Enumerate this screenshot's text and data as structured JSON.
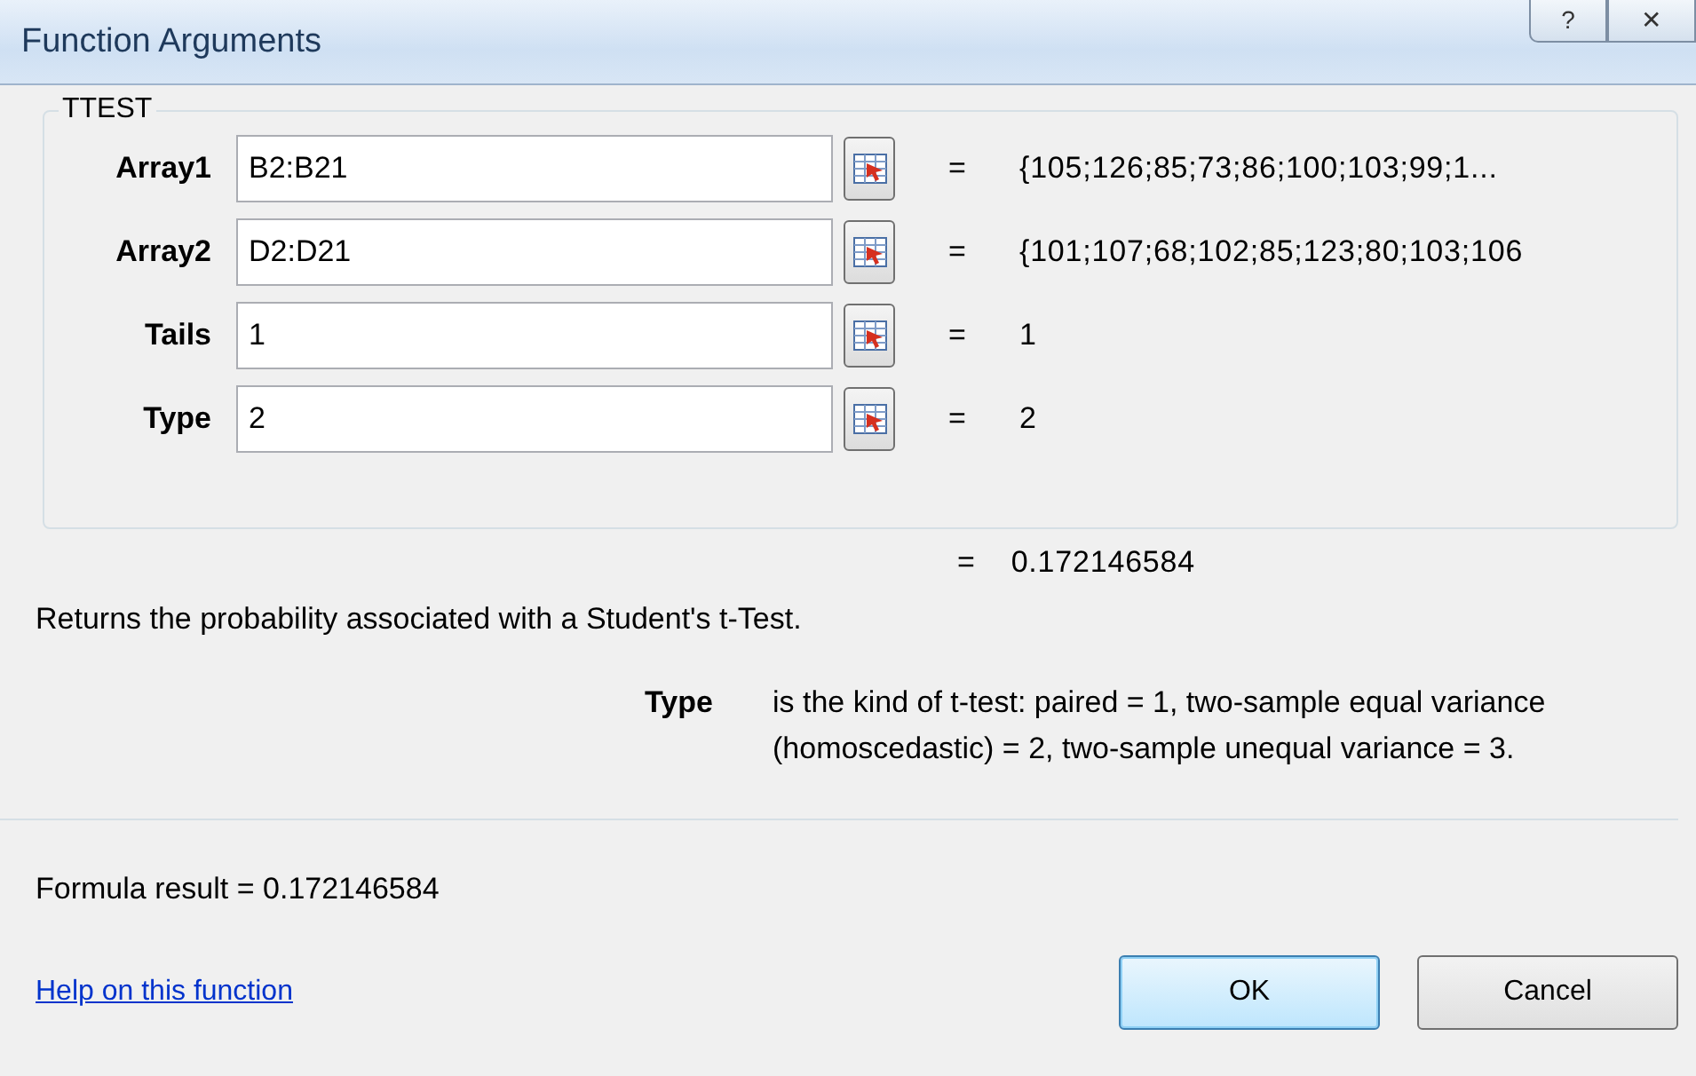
{
  "window": {
    "title": "Function Arguments"
  },
  "title_buttons": [
    {
      "kind": "help",
      "label": "?"
    },
    {
      "kind": "close",
      "label": "✕"
    }
  ],
  "group": {
    "title": "TTEST",
    "arguments": [
      {
        "label": "Array1",
        "value": "B2:B21",
        "equals": "=",
        "result": "{105;126;85;73;86;100;103;99;1..."
      },
      {
        "label": "Array2",
        "value": "D2:D21",
        "equals": "=",
        "result": "{101;107;68;102;85;123;80;103;106"
      },
      {
        "label": "Tails",
        "value": "1",
        "equals": "=",
        "result": "1"
      },
      {
        "label": "Type",
        "value": "2",
        "equals": "=",
        "result": "2"
      }
    ]
  },
  "function_result": {
    "equals": "=",
    "value": "0.172146584"
  },
  "description": "Returns the probability associated with a Student's t-Test.",
  "argument_help": {
    "name": "Type",
    "text": "is the kind of t-test: paired = 1, two-sample equal variance (homoscedastic) = 2, two-sample unequal variance = 3."
  },
  "formula_result": {
    "label": "Formula result =",
    "value": "0.172146584"
  },
  "help_link": "Help on this function",
  "buttons": [
    {
      "label": "OK",
      "default": true
    },
    {
      "label": "Cancel",
      "default": false
    }
  ]
}
